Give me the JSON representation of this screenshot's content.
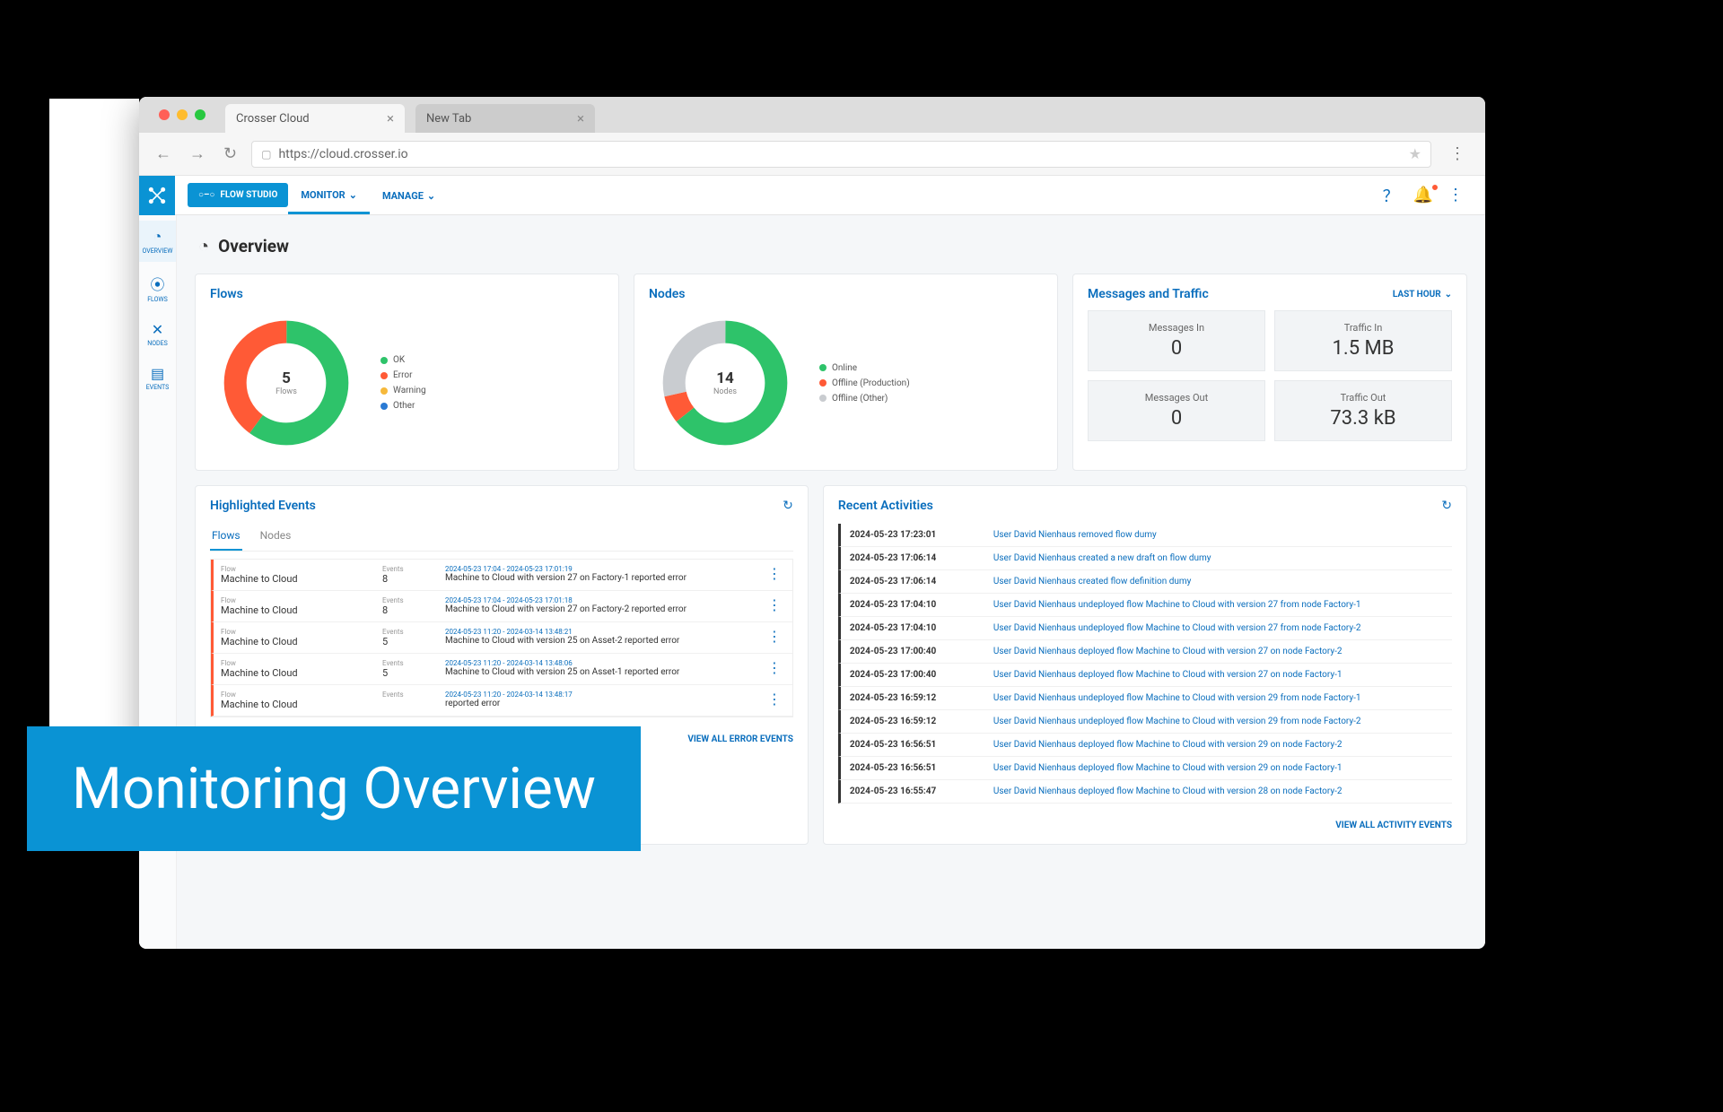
{
  "browser": {
    "tabs": [
      {
        "title": "Crosser Cloud",
        "active": true
      },
      {
        "title": "New Tab",
        "active": false
      }
    ],
    "url": "https://cloud.crosser.io"
  },
  "topnav": {
    "flow_studio": "FLOW STUDIO",
    "items": [
      {
        "label": "MONITOR",
        "active": true
      },
      {
        "label": "MANAGE",
        "active": false
      }
    ]
  },
  "side_rail": [
    {
      "label": "OVERVIEW",
      "icon": "◔",
      "active": true
    },
    {
      "label": "FLOWS",
      "icon": "⦿",
      "active": false
    },
    {
      "label": "NODES",
      "icon": "✕",
      "active": false
    },
    {
      "label": "EVENTS",
      "icon": "▤",
      "active": false
    }
  ],
  "page": {
    "title": "Overview"
  },
  "flows_card": {
    "title": "Flows",
    "center_value": "5",
    "center_label": "Flows",
    "legend": [
      {
        "label": "OK",
        "color": "#2ec36a"
      },
      {
        "label": "Error",
        "color": "#ff5a36"
      },
      {
        "label": "Warning",
        "color": "#f6b93b"
      },
      {
        "label": "Other",
        "color": "#2a7ad4"
      }
    ]
  },
  "nodes_card": {
    "title": "Nodes",
    "center_value": "14",
    "center_label": "Nodes",
    "legend": [
      {
        "label": "Online",
        "color": "#2ec36a"
      },
      {
        "label": "Offline (Production)",
        "color": "#ff5a36"
      },
      {
        "label": "Offline (Other)",
        "color": "#c9ccd0"
      }
    ]
  },
  "metrics_card": {
    "title": "Messages and Traffic",
    "range": "LAST HOUR",
    "tiles": [
      {
        "label": "Messages In",
        "value": "0"
      },
      {
        "label": "Traffic In",
        "value": "1.5 MB"
      },
      {
        "label": "Messages Out",
        "value": "0"
      },
      {
        "label": "Traffic Out",
        "value": "73.3 kB"
      }
    ]
  },
  "highlighted": {
    "title": "Highlighted Events",
    "tabs": [
      "Flows",
      "Nodes"
    ],
    "active_tab": "Flows",
    "col_flow": "Flow",
    "col_events": "Events",
    "rows": [
      {
        "flow": "Machine to Cloud",
        "events": "8",
        "time": "2024-05-23 17:04 - 2024-05-23 17:01:19",
        "msg": "Machine to Cloud with version 27 on Factory-1 reported error"
      },
      {
        "flow": "Machine to Cloud",
        "events": "8",
        "time": "2024-05-23 17:04 - 2024-05-23 17:01:18",
        "msg": "Machine to Cloud with version 27 on Factory-2 reported error"
      },
      {
        "flow": "Machine to Cloud",
        "events": "5",
        "time": "2024-05-23 11:20 - 2024-03-14 13:48:21",
        "msg": "Machine to Cloud with version 25 on Asset-2 reported error"
      },
      {
        "flow": "Machine to Cloud",
        "events": "5",
        "time": "2024-05-23 11:20 - 2024-03-14 13:48:06",
        "msg": "Machine to Cloud with version 25 on Asset-1 reported error"
      },
      {
        "flow": "Machine to Cloud",
        "events": "",
        "time": "2024-05-23 11:20 - 2024-03-14 13:48:17",
        "msg": "reported error"
      }
    ],
    "footer": "VIEW ALL ERROR EVENTS"
  },
  "activities": {
    "title": "Recent Activities",
    "rows": [
      {
        "time": "2024-05-23 17:23:01",
        "msg": "User David Nienhaus removed flow dumy"
      },
      {
        "time": "2024-05-23 17:06:14",
        "msg": "User David Nienhaus created a new draft on flow dumy"
      },
      {
        "time": "2024-05-23 17:06:14",
        "msg": "User David Nienhaus created flow definition dumy"
      },
      {
        "time": "2024-05-23 17:04:10",
        "msg": "User David Nienhaus undeployed flow Machine to Cloud with version 27 from node Factory-1"
      },
      {
        "time": "2024-05-23 17:04:10",
        "msg": "User David Nienhaus undeployed flow Machine to Cloud with version 27 from node Factory-2"
      },
      {
        "time": "2024-05-23 17:00:40",
        "msg": "User David Nienhaus deployed flow Machine to Cloud with version 27 on node Factory-2"
      },
      {
        "time": "2024-05-23 17:00:40",
        "msg": "User David Nienhaus deployed flow Machine to Cloud with version 27 on node Factory-1"
      },
      {
        "time": "2024-05-23 16:59:12",
        "msg": "User David Nienhaus undeployed flow Machine to Cloud with version 29 from node Factory-1"
      },
      {
        "time": "2024-05-23 16:59:12",
        "msg": "User David Nienhaus undeployed flow Machine to Cloud with version 29 from node Factory-2"
      },
      {
        "time": "2024-05-23 16:56:51",
        "msg": "User David Nienhaus deployed flow Machine to Cloud with version 29 on node Factory-2"
      },
      {
        "time": "2024-05-23 16:56:51",
        "msg": "User David Nienhaus deployed flow Machine to Cloud with version 29 on node Factory-1"
      },
      {
        "time": "2024-05-23 16:55:47",
        "msg": "User David Nienhaus deployed flow Machine to Cloud with version 28 on node Factory-2"
      }
    ],
    "footer": "VIEW ALL ACTIVITY EVENTS"
  },
  "chart_data": [
    {
      "type": "pie",
      "title": "Flows",
      "total": 5,
      "series": [
        {
          "name": "OK",
          "value": 3,
          "color": "#2ec36a"
        },
        {
          "name": "Error",
          "value": 2,
          "color": "#ff5a36"
        },
        {
          "name": "Warning",
          "value": 0,
          "color": "#f6b93b"
        },
        {
          "name": "Other",
          "value": 0,
          "color": "#2a7ad4"
        }
      ]
    },
    {
      "type": "pie",
      "title": "Nodes",
      "total": 14,
      "series": [
        {
          "name": "Online",
          "value": 9,
          "color": "#2ec36a"
        },
        {
          "name": "Offline (Production)",
          "value": 1,
          "color": "#ff5a36"
        },
        {
          "name": "Offline (Other)",
          "value": 4,
          "color": "#c9ccd0"
        }
      ]
    }
  ],
  "banner": "Monitoring Overview"
}
